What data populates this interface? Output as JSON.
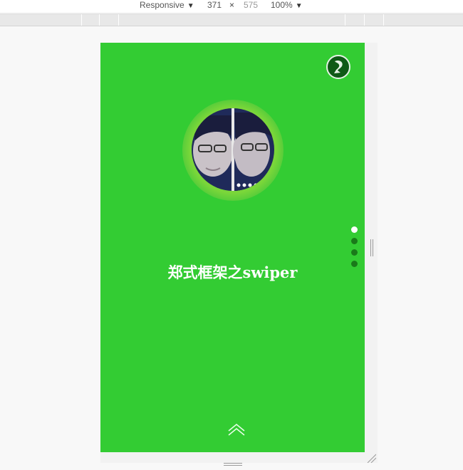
{
  "toolbar": {
    "device": "Responsive",
    "width": "371",
    "times": "×",
    "height": "575",
    "zoom": "100%"
  },
  "app": {
    "headline": "郑式框架之swiper",
    "pagination": [
      {
        "active": true
      },
      {
        "active": false
      },
      {
        "active": false
      },
      {
        "active": false
      }
    ]
  },
  "icons": {
    "logo": "music-logo-icon",
    "avatar": "profile-photo",
    "next": "chevron-up-icon"
  },
  "colors": {
    "background": "#33cc33",
    "dot_active": "#ffffff",
    "dot_inactive": "#1a7a1a",
    "glow": "#7ad63a"
  }
}
